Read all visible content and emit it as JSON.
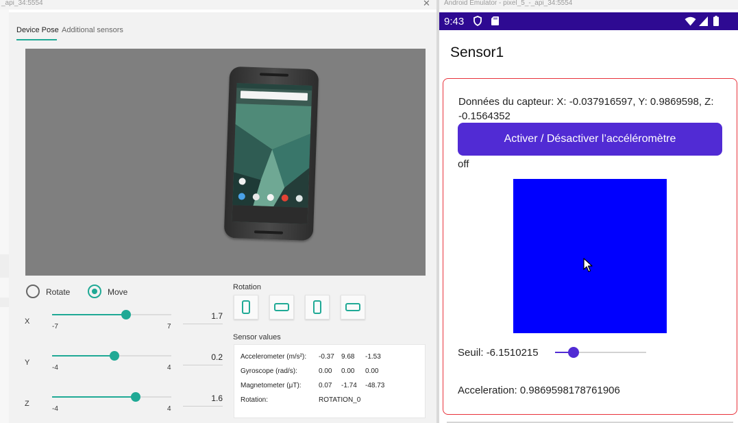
{
  "left_window": {
    "title": "_api_34:5554",
    "close_glyph": "✕",
    "tabs": [
      {
        "label": "Device Pose",
        "active": true
      },
      {
        "label": "Additional sensors",
        "active": false
      }
    ],
    "mode": {
      "options": [
        "Rotate",
        "Move"
      ],
      "selected": "Move"
    },
    "sliders": [
      {
        "axis": "X",
        "min": "-7",
        "max": "7",
        "value": "1.7",
        "fraction": 0.62
      },
      {
        "axis": "Y",
        "min": "-4",
        "max": "4",
        "value": "0.2",
        "fraction": 0.525
      },
      {
        "axis": "Z",
        "min": "-4",
        "max": "4",
        "value": "1.6",
        "fraction": 0.7
      }
    ],
    "rotation": {
      "label": "Rotation",
      "buttons": [
        "portrait-icon",
        "landscape-icon",
        "reverse-portrait-icon",
        "reverse-landscape-icon"
      ]
    },
    "sensor_values": {
      "label": "Sensor values",
      "rows": [
        {
          "name": "Accelerometer (m/s²):",
          "values": [
            "-0.37",
            "9.68",
            "-1.53"
          ]
        },
        {
          "name": "Gyroscope (rad/s):",
          "values": [
            "0.00",
            "0.00",
            "0.00"
          ]
        },
        {
          "name": "Magnetometer (μT):",
          "values": [
            "0.07",
            "-1.74",
            "-48.73"
          ]
        },
        {
          "name": "Rotation:",
          "values": [
            "ROTATION_0"
          ]
        }
      ]
    }
  },
  "emulator": {
    "title": "Android Emulator - pixel_5_-_api_34:5554",
    "status_bar": {
      "time": "9:43",
      "icons": [
        "shield-icon",
        "sd-card-icon",
        "wifi-icon",
        "signal-icon",
        "battery-icon"
      ],
      "color": "#2e0a92"
    },
    "app": {
      "title": "Sensor1",
      "sensor_data": "Données du capteur: X: -0.037916597, Y: 0.9869598, Z: -0.1564352",
      "toggle_button": "Activer / Désactiver l’accéléromètre",
      "state": "off",
      "box_color": "#0000ff",
      "threshold_label": "Seuil: -6.1510215",
      "threshold_fraction": 0.2,
      "acceleration_label": "Acceleration: 0.9869598178761906",
      "accent": "#512bd4",
      "frame_color": "#e8313a"
    }
  },
  "accent": "#1fa995"
}
